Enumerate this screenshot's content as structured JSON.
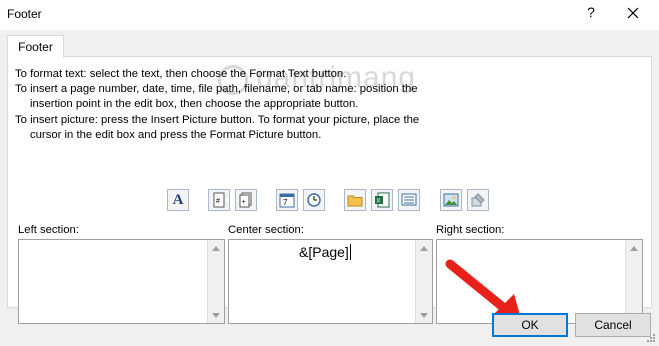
{
  "window": {
    "title": "Footer",
    "help": "?"
  },
  "tab": {
    "label": "Footer"
  },
  "instructions": [
    "To format text:  select the text, then choose the Format Text button.",
    "To insert a page number, date, time, file path, filename, or tab name:  position the",
    "insertion point in the edit box, then choose the appropriate button.",
    "To insert picture: press the Insert Picture button.  To format your picture, place the",
    "cursor in the edit box and press the Format Picture button."
  ],
  "watermark": "uantrimang",
  "toolbar": {
    "buttons": [
      {
        "name": "format-text-button",
        "icon": "format-text-icon"
      },
      {
        "name": "insert-page-number-button",
        "icon": "page-number-icon"
      },
      {
        "name": "insert-number-of-pages-button",
        "icon": "number-of-pages-icon"
      },
      {
        "name": "insert-date-button",
        "icon": "calendar-icon"
      },
      {
        "name": "insert-time-button",
        "icon": "clock-icon"
      },
      {
        "name": "insert-file-path-button",
        "icon": "folder-icon"
      },
      {
        "name": "insert-file-name-button",
        "icon": "excel-file-icon"
      },
      {
        "name": "insert-sheet-name-button",
        "icon": "sheet-tab-icon"
      },
      {
        "name": "insert-picture-button",
        "icon": "picture-icon"
      },
      {
        "name": "format-picture-button",
        "icon": "format-picture-icon"
      }
    ],
    "format_text_glyph": "A"
  },
  "sections": {
    "left": {
      "label": "Left section:",
      "value": ""
    },
    "center": {
      "label": "Center section:",
      "value": "&[Page]"
    },
    "right": {
      "label": "Right section:",
      "value": ""
    }
  },
  "buttons": {
    "ok": "OK",
    "cancel": "Cancel"
  },
  "colors": {
    "accent": "#0078d7",
    "annotation_arrow": "#e8211b"
  }
}
